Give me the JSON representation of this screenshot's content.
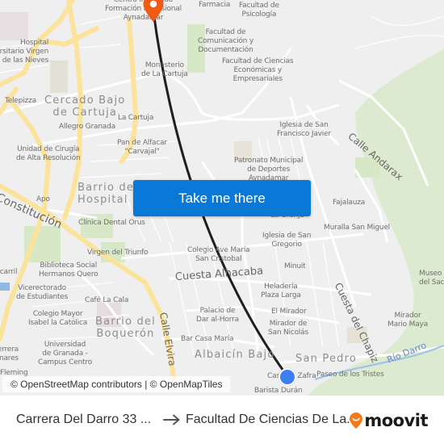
{
  "map": {
    "attribution": "© OpenStreetMap contributors | © OpenMapTiles",
    "cta_label": "Take me there",
    "colors": {
      "background": "#efefef",
      "road_major": "#fbe39b",
      "road_minor": "#ffffff",
      "park": "#d7e8c7",
      "water": "#8fb8e3",
      "route": "#1f1f1f",
      "destination_pin": "#f25a14",
      "origin_dot": "#3c7ff5",
      "cta": "#0a78d7"
    },
    "neighborhoods": [
      {
        "id": "cercado",
        "text": "Cercado Bajo\nde Cartuja"
      },
      {
        "id": "hospital-real",
        "text": "Barrio del\nHospital Real"
      },
      {
        "id": "boqueron",
        "text": "Barrio del\nBoquerón"
      },
      {
        "id": "albaicin",
        "text": "Albaicín Bajo"
      },
      {
        "id": "san-pedro",
        "text": "San Pedro"
      }
    ],
    "streets": [
      {
        "id": "constitucion",
        "text": "Constitución"
      },
      {
        "id": "andarax",
        "text": "Calle Andarax"
      },
      {
        "id": "alhacaba",
        "text": "Cuesta Alhacaba"
      },
      {
        "id": "chapiz",
        "text": "Cuesta del Chapiz"
      },
      {
        "id": "elvira",
        "text": "Calle Elvira"
      },
      {
        "id": "rio-darro",
        "text": "Río Darro"
      }
    ],
    "pois": [
      {
        "id": "centro-integrado",
        "text": "Centro Integrado\nFormación Profesional\nAynadamar"
      },
      {
        "id": "farmacia",
        "text": "Farmacia"
      },
      {
        "id": "psicologia",
        "text": "Facultad de\nPsicología"
      },
      {
        "id": "comunicacion",
        "text": "Facultad de\nComunicación y\nDocumentación"
      },
      {
        "id": "economicas",
        "text": "Facultad de Ciencias\nEconómicas y\nEmpresariales"
      },
      {
        "id": "monasterio",
        "text": "Monasterio\nde La Cartuja"
      },
      {
        "id": "hospital",
        "text": "Hospital\nUniversitario Virgen\nde las Nieves"
      },
      {
        "id": "telepizza",
        "text": "Telepizza"
      },
      {
        "id": "la-cartuja",
        "text": "La Cartuja"
      },
      {
        "id": "allegro",
        "text": "Allegro Granada"
      },
      {
        "id": "pan-alfacar",
        "text": "Pan de Alfacar\n\"Carvajal\""
      },
      {
        "id": "unidad-cirugia",
        "text": "Unidad de Cirugía\nde Alta Resolución"
      },
      {
        "id": "iglesia-san-francisco",
        "text": "Iglesia de San\nFrancisco Javier"
      },
      {
        "id": "patronato",
        "text": "Patronato Municipal\nde Deportes\nAynadamar"
      },
      {
        "id": "apo",
        "text": "Apo"
      },
      {
        "id": "clinica-orus",
        "text": "Clínica Dental Orus"
      },
      {
        "id": "fajalauza",
        "text": "Fajalauza"
      },
      {
        "id": "la-granja",
        "text": "La Granja"
      },
      {
        "id": "muralla",
        "text": "Muralla San Miguel"
      },
      {
        "id": "iglesia-san-gregorio",
        "text": "Iglesia de San\nGregorio"
      },
      {
        "id": "colegio-ave-maria",
        "text": "Colegio Ave María\nSan Cristobal"
      },
      {
        "id": "virgen-triunfo",
        "text": "Virgen del Triunfo"
      },
      {
        "id": "biblioteca",
        "text": "Biblioteca Social\nHermanos Quero"
      },
      {
        "id": "ferrocarril",
        "text": "Ferrocarril"
      },
      {
        "id": "vicerrectorado",
        "text": "Vicerectorado\nde Estudiantes"
      },
      {
        "id": "minuit",
        "text": "Minuit"
      },
      {
        "id": "museo-sacromonte",
        "text": "Museo\ndel Sacromonte"
      },
      {
        "id": "cafe-la-cala",
        "text": "Café La Cala"
      },
      {
        "id": "heladeria",
        "text": "Heladería\nPlaza Larga"
      },
      {
        "id": "colegio-mayor",
        "text": "Colegio Mayor\nIsabel la Católica"
      },
      {
        "id": "palacio-dar",
        "text": "Palacio de\nDar al-Horra"
      },
      {
        "id": "el-mirador",
        "text": "El Mirador"
      },
      {
        "id": "mirador-san-nicolas",
        "text": "Mirador de\nSan Nicolás"
      },
      {
        "id": "mirador-mario-maya",
        "text": "Mirador\nMario Maya"
      },
      {
        "id": "bar-casa-maria",
        "text": "Bar Casa María"
      },
      {
        "id": "universidad",
        "text": "Universidad\nde Granada -\nCampus Centro"
      },
      {
        "id": "herrera",
        "text": "Instituto Herrera\nde Linares"
      },
      {
        "id": "casa-zafra",
        "text": "Casa de Zafra"
      },
      {
        "id": "paseo-tristes",
        "text": "Paseo de los Tristes"
      },
      {
        "id": "barista-duran",
        "text": "Barista Durán"
      },
      {
        "id": "fleming",
        "text": "Fleming"
      }
    ]
  },
  "footer": {
    "origin": "Carrera Del Darro 33 ...",
    "destination": "Facultad De Ciencias De La...",
    "brand": "moovit",
    "brand_color": "#f27a1a"
  }
}
